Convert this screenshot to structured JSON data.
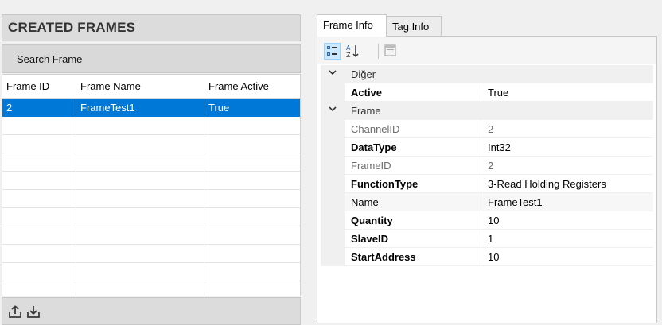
{
  "left_panel": {
    "header": "CREATED FRAMES",
    "search_label": "Search Frame",
    "columns": [
      "Frame ID",
      "Frame Name",
      "Frame Active"
    ],
    "rows": [
      {
        "id": "2",
        "name": "FrameTest1",
        "active": "True"
      }
    ],
    "bottom_icons": [
      "upload-icon",
      "download-icon"
    ]
  },
  "right_panel": {
    "tabs": [
      "Frame Info",
      "Tag Info"
    ],
    "active_tab": "Frame Info",
    "toolbar_icons": [
      "categorized-view-icon",
      "alphabetical-sort-icon",
      "property-pages-icon"
    ],
    "categories": [
      {
        "name": "Diğer",
        "properties": [
          {
            "name": "Active",
            "value": "True"
          }
        ]
      },
      {
        "name": "Frame",
        "properties": [
          {
            "name": "ChannelID",
            "value": "2"
          },
          {
            "name": "DataType",
            "value": "Int32"
          },
          {
            "name": "FrameID",
            "value": "2"
          },
          {
            "name": "FunctionType",
            "value": "3-Read Holding Registers"
          },
          {
            "name": "Name",
            "value": "FrameTest1"
          },
          {
            "name": "Quantity",
            "value": "10"
          },
          {
            "name": "SlaveID",
            "value": "1"
          },
          {
            "name": "StartAddress",
            "value": "10"
          }
        ]
      }
    ]
  },
  "colors": {
    "selection": "#0078d7",
    "panel_bg": "#f0f0f0",
    "header_bg": "#dcdcdc"
  }
}
